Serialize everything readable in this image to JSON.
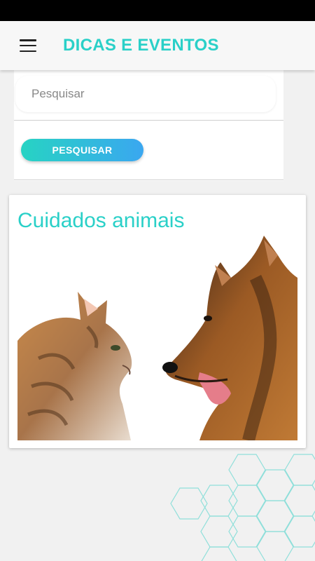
{
  "app_bar": {
    "title": "DICAS E EVENTOS",
    "menu_icon": "hamburger-menu-icon"
  },
  "search": {
    "placeholder": "Pesquisar",
    "value": "",
    "button_label": "PESQUISAR"
  },
  "cards": [
    {
      "title": "Cuidados animais",
      "image": "cat-and-dog-photo"
    }
  ],
  "colors": {
    "accent": "#2ad0c8",
    "button_gradient_start": "#27d3c3",
    "button_gradient_end": "#3aa7f0",
    "status_bar": "#000000",
    "background": "#f1f1f1"
  }
}
